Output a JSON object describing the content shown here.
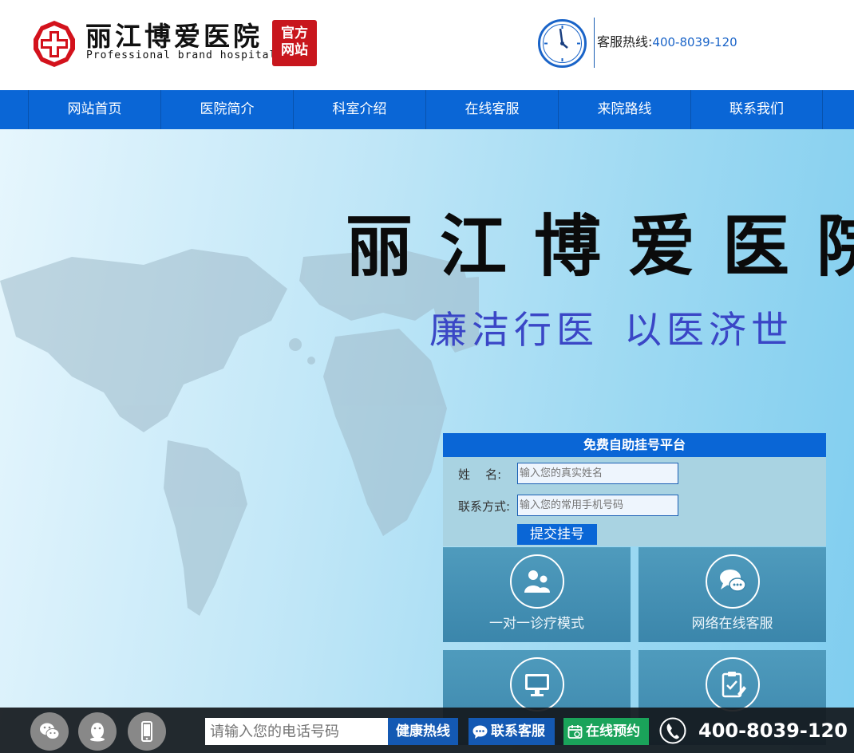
{
  "header": {
    "logo_title": "丽江博爱医院",
    "logo_subtitle": "Professional brand hospital",
    "seal": [
      "官方",
      "网站"
    ],
    "hotline_label": "客服热线:",
    "hotline_number": "400-8039-120"
  },
  "nav": {
    "items": [
      "网站首页",
      "医院简介",
      "科室介绍",
      "在线客服",
      "来院路线",
      "联系我们"
    ]
  },
  "banner": {
    "title": "丽江博爱医院",
    "slogan_left": "廉洁行医",
    "slogan_right": "以医济世"
  },
  "registration": {
    "title": "免费自助挂号平台",
    "name_label": "姓    名:",
    "name_placeholder": "输入您的真实姓名",
    "phone_label": "联系方式:",
    "phone_placeholder": "输入您的常用手机号码",
    "submit_label": "提交挂号"
  },
  "tiles": [
    {
      "label": "一对一诊疗模式",
      "icon": "users-icon"
    },
    {
      "label": "网络在线客服",
      "icon": "chat-bubbles-icon"
    },
    {
      "label": "",
      "icon": "monitor-icon"
    },
    {
      "label": "",
      "icon": "clipboard-check-icon"
    }
  ],
  "bottom_bar": {
    "phone_placeholder": "请输入您的电话号码",
    "hotline_button": "健康热线",
    "chat_button": "联系客服",
    "booking_button": "在线预约",
    "phone_number": "400-8039-120"
  },
  "colors": {
    "nav_blue": "#0a66d6",
    "seal_red": "#c8161d",
    "slogan_blue": "#3a46c6",
    "booking_green": "#1aa35a"
  }
}
